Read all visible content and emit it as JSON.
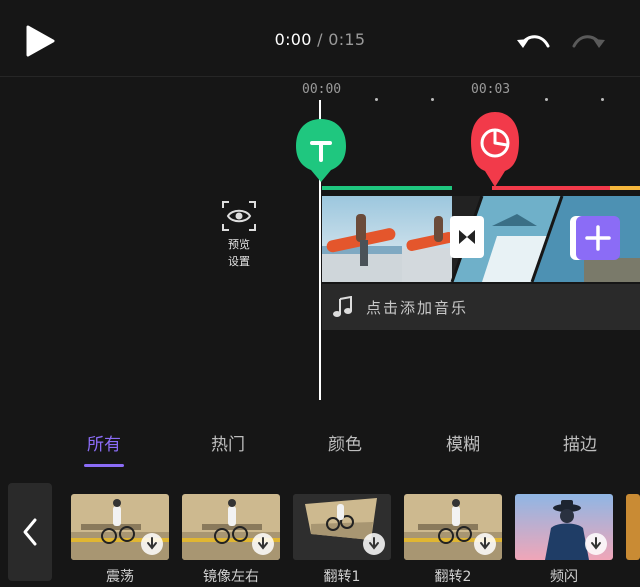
{
  "player": {
    "current_time": "0:00",
    "separator": "/",
    "total_time": "0:15"
  },
  "timeline": {
    "ruler": [
      "00:00",
      "00:03"
    ]
  },
  "preview_settings": {
    "line1": "预览",
    "line2": "设置"
  },
  "music_track": {
    "label": "点击添加音乐"
  },
  "colors": {
    "accent": "#8b6cf6",
    "marker_green": "#1fc77f",
    "marker_red": "#f23a4a",
    "bar_yellow": "#f4b63c"
  },
  "categories": [
    {
      "label": "所有",
      "active": true
    },
    {
      "label": "热门",
      "active": false
    },
    {
      "label": "颜色",
      "active": false
    },
    {
      "label": "模糊",
      "active": false
    },
    {
      "label": "描边",
      "active": false
    }
  ],
  "effects": [
    {
      "label": "震荡",
      "icon": "download-icon"
    },
    {
      "label": "镜像左右",
      "icon": "download-icon"
    },
    {
      "label": "翻转1",
      "icon": "download-icon"
    },
    {
      "label": "翻转2",
      "icon": "download-icon"
    },
    {
      "label": "频闪",
      "icon": "download-icon"
    }
  ]
}
